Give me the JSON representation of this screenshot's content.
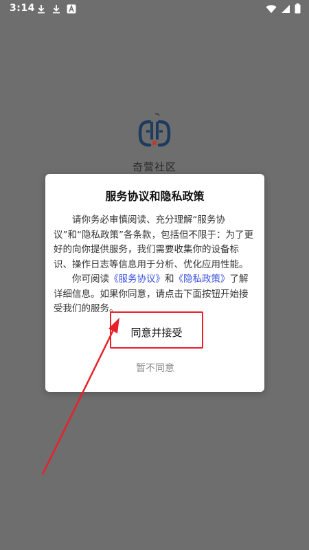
{
  "status_bar": {
    "time": "3:14"
  },
  "app": {
    "name": "奇营社区"
  },
  "dialog": {
    "title": "服务协议和隐私政策",
    "paragraph1": "请你务必审慎阅读、充分理解“服务协议”和“隐私政策”各条款，包括但不限于：为了更好的向你提供服务，我们需要收集你的设备标识、操作日志等信息用于分析、优化应用性能。",
    "p2_prefix": "你可阅读",
    "p2_link1": "《服务协议》",
    "p2_and": "和",
    "p2_link2": "《隐私政策》",
    "p2_suffix": "了解详细信息。如果你同意，请点击下面按钮开始接受我们的服务。",
    "agree_label": "同意并接受",
    "decline_label": "暂不同意"
  },
  "colors": {
    "backdrop": "#6e6e6e",
    "link": "#3b4fe0",
    "highlight": "#e8202a"
  }
}
